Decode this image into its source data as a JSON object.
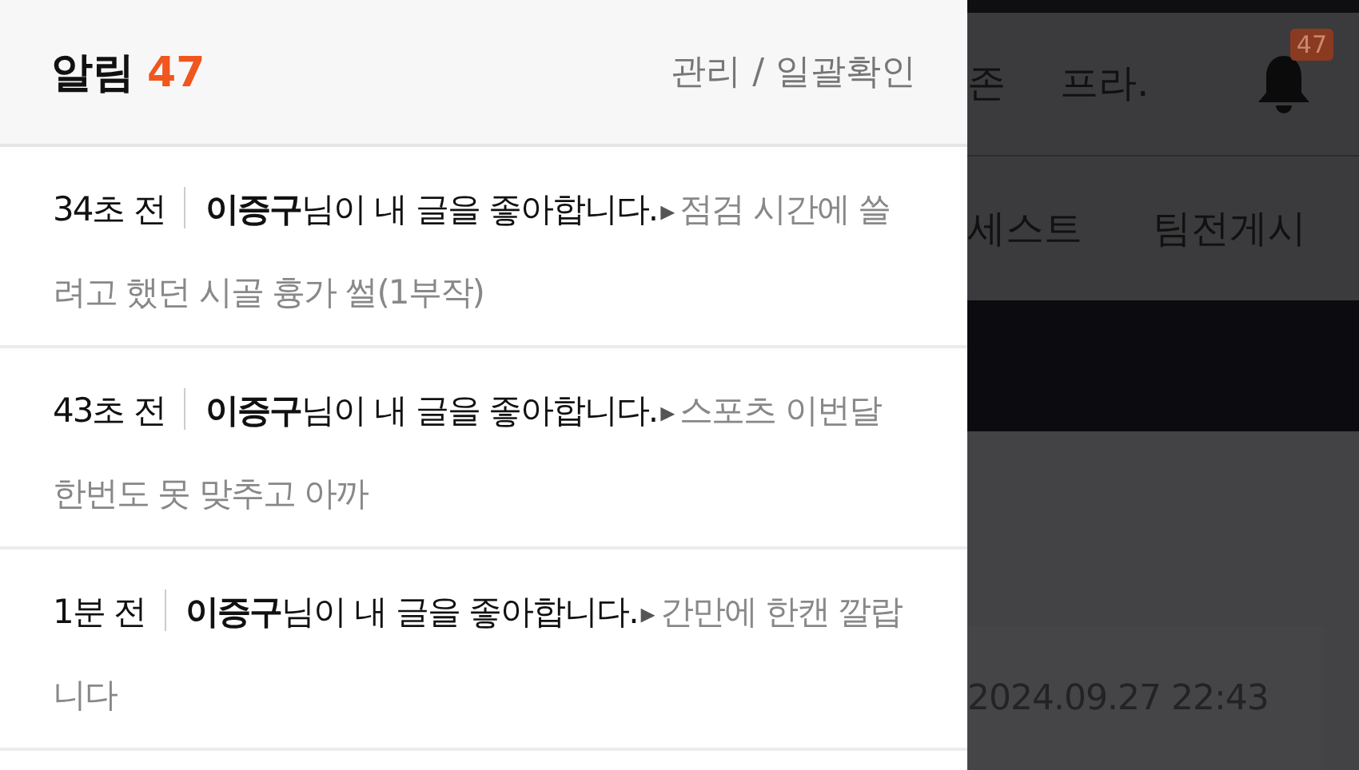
{
  "notifications_panel": {
    "title": "알림",
    "count": "47",
    "actions": "관리 / 일괄확인",
    "items": [
      {
        "time": "34초 전",
        "message": "**이증구**님이 내 글을 좋아합니다.",
        "marker": "▸",
        "post": "점검 시간에 쓸려고 했던 시골 흉가 썰(1부작)"
      },
      {
        "time": "43초 전",
        "message": "**이증구**님이 내 글을 좋아합니다.",
        "marker": "▸",
        "post": "스포츠 이번달 한번도 못 맞추고 아까"
      },
      {
        "time": "1분 전",
        "message": "**이증구**님이 내 글을 좋아합니다.",
        "marker": "▸",
        "post": "간만에 한캔 깔랍니다"
      }
    ]
  },
  "background_page": {
    "nav_items": [
      "존",
      "프라."
    ],
    "bell_badge": "47",
    "sub_nav_items": [
      "세스트",
      "팀전게시"
    ],
    "post_date": "2024.09.27 22:43"
  }
}
